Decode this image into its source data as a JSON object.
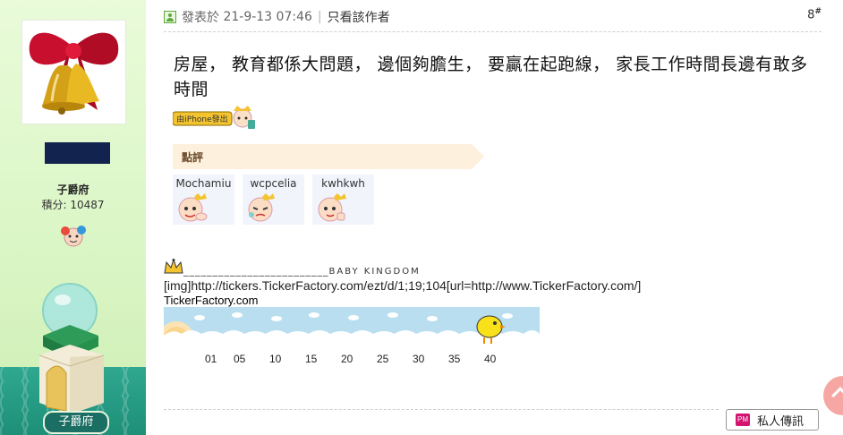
{
  "user": {
    "name": "子爵府",
    "points_label": "積分: 10487",
    "rank_tag": "子爵府"
  },
  "post": {
    "meta_prefix": "發表於",
    "date": "21-9-13 07:46",
    "only_author": "只看該作者",
    "floor": "8",
    "floor_mark": "#",
    "message": "房屋， 教育都係大問題， 邊個夠膽生， 要贏在起跑線， 家長工作時間長邊有敢多時間",
    "iphone_badge": "由iPhone發出",
    "rating_title": "點評",
    "raters": [
      "Mochamiu",
      "wcpcelia",
      "kwhkwh"
    ]
  },
  "signature": {
    "underline": "_________________________",
    "kingdom": "BABY KINGDOM",
    "img_text": "[img]http://tickers.TickerFactory.com/ezt/d/1;19;104[url=http://www.TickerFactory.com/]",
    "ticker_label": "TickerFactory.com",
    "ticks": [
      "01",
      "05",
      "10",
      "15",
      "20",
      "25",
      "30",
      "35",
      "40"
    ]
  },
  "actions": {
    "pm_icon": "PM",
    "pm_label": "私人傳訊"
  },
  "colors": {
    "sidebar_bg": "#dbf6c6",
    "rank_bar": "#13234f",
    "rating_header": "#fdf0dc",
    "ticker_sky": "#b9def0",
    "pm_icon": "#d4146e"
  }
}
